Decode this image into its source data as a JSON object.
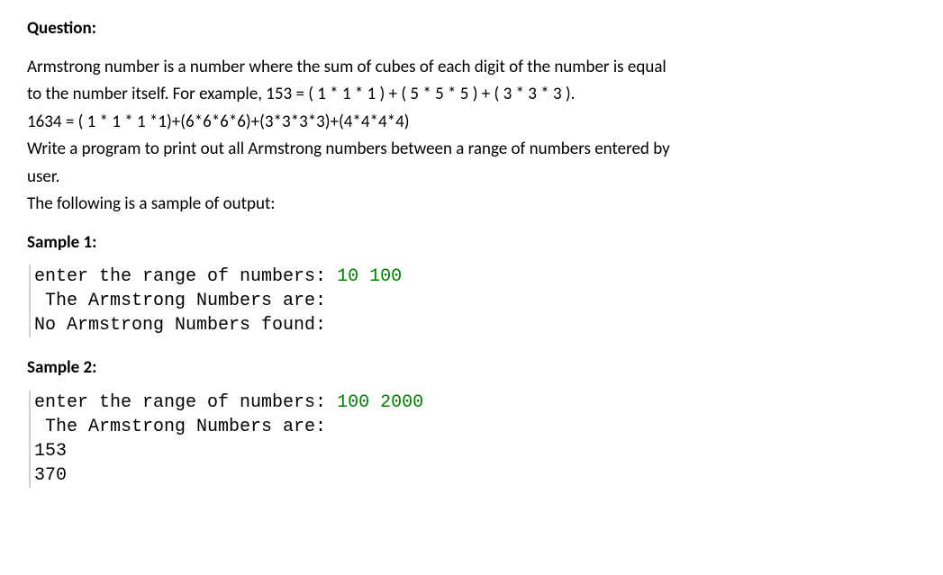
{
  "question": {
    "heading": "Question:",
    "para1_line1": "Armstrong number is a number where the sum of cubes of each digit of the number is equal",
    "para1_line2": "to the number itself. For example, 153 = ( 1 * 1 * 1 ) + ( 5 * 5 * 5 ) + ( 3 * 3 * 3 ).",
    "para1_line3": "1634 = ( 1 * 1 * 1 *1)+(6*6*6*6)+(3*3*3*3)+(4*4*4*4)",
    "para2_line1": "Write a program to print out all Armstrong numbers between a range of numbers entered by",
    "para2_line2": "user.",
    "para3": "The following is a sample of output:"
  },
  "sample1": {
    "heading": "Sample 1:",
    "prompt": "enter the range of numbers: ",
    "input": "10 100",
    "line2": " The Armstrong Numbers are:",
    "line3": "No Armstrong Numbers found:"
  },
  "sample2": {
    "heading": "Sample 2:",
    "prompt": "enter the range of numbers: ",
    "input": "100 2000",
    "line2": " The Armstrong Numbers are:",
    "line3": "153",
    "line4": "370"
  }
}
